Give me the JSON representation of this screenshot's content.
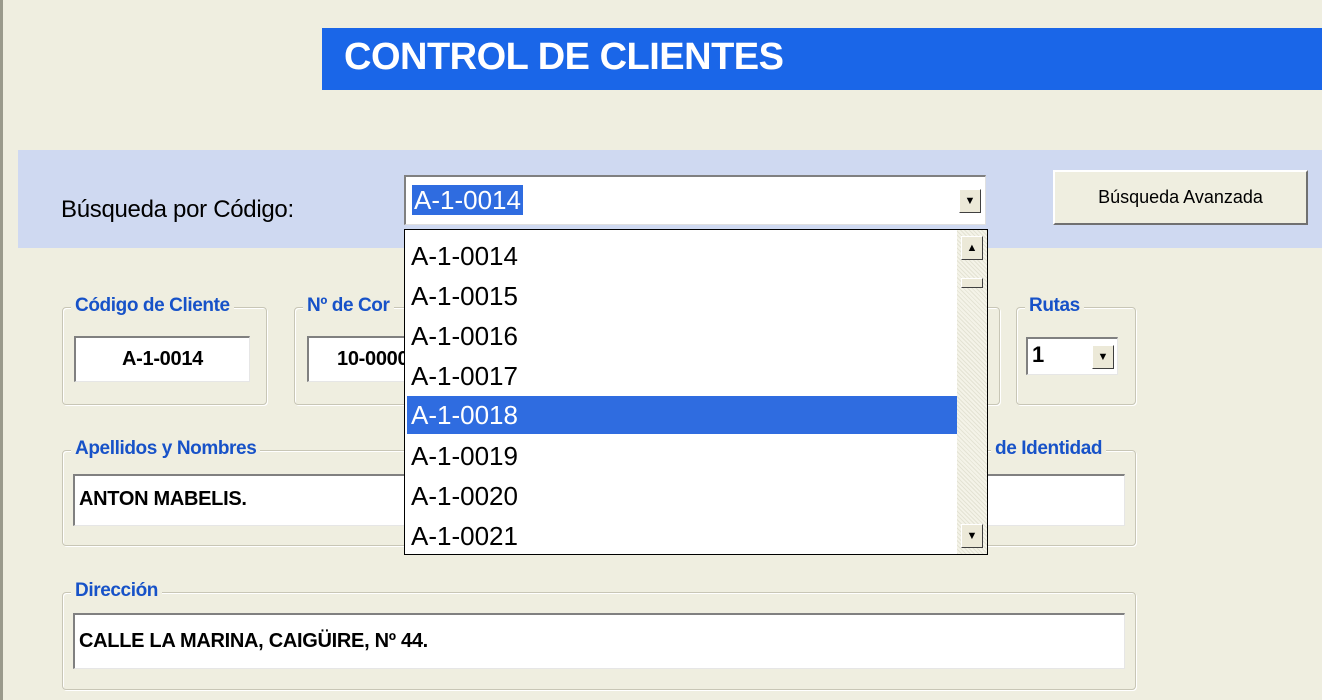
{
  "title": "CONTROL DE CLIENTES",
  "search": {
    "label": "Búsqueda por Código:",
    "selected_value": "A-1-0014",
    "advanced_button": "Búsqueda Avanzada"
  },
  "dropdown": {
    "items": [
      "A-1-0014",
      "A-1-0015",
      "A-1-0016",
      "A-1-0017",
      "A-1-0018",
      "A-1-0019",
      "A-1-0020",
      "A-1-0021"
    ],
    "highlighted": "A-1-0018"
  },
  "fields": {
    "codigo_cliente": {
      "label": "Código de Cliente",
      "value": "A-1-0014"
    },
    "num_contrato": {
      "label": "Nº de Cor",
      "value": "10-0000"
    },
    "rutas": {
      "label": "Rutas",
      "value": "1"
    },
    "apellidos_nombres": {
      "label": "Apellidos y Nombres",
      "value": "ANTON MABELIS."
    },
    "identidad": {
      "label": "de Identidad",
      "value": ""
    },
    "direccion": {
      "label": "Dirección",
      "value": "CALLE LA MARINA, CAIGÜIRE, Nº 44."
    }
  },
  "colors": {
    "banner": "#1a66e8",
    "search_band": "#cfd9f1",
    "background": "#efeee0",
    "legend_text": "#1752c8",
    "highlight": "#2f6ce0"
  },
  "icons": [
    "chevron-down-icon",
    "scroll-up-icon",
    "scroll-down-icon"
  ]
}
